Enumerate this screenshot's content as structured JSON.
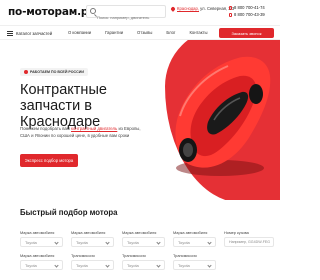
{
  "header": {
    "logo": "по-моторам.рф",
    "search_placeholder": "Поиск: например, двигатель",
    "location_city": "Краснодар,",
    "location_address": " ул. Северная, 3/3",
    "phones": [
      "8 800 700-41-74",
      "8 800 700-43-39"
    ]
  },
  "nav": {
    "catalog": "Каталог запчастей",
    "links": [
      "О компании",
      "Гарантии",
      "Отзывы",
      "Блог",
      "Контакты"
    ],
    "callback": "Заказать звонок"
  },
  "hero": {
    "badge": "РАБОТАЕМ ПО ВСЕЙ РОССИИ",
    "title": "Контрактные запчасти в Краснодаре",
    "desc_part1": "Поможем подобрать вам ",
    "desc_link": "контрактный двигатель",
    "desc_part2": " из Европы, США и Японии по хорошей цене, в удобные вам сроки",
    "button": "Экспресс подбор мотора"
  },
  "quick_pick": {
    "title": "Быстрый подбор мотора",
    "row1": [
      {
        "label": "Марка автомобиля",
        "value": "Toyota"
      },
      {
        "label": "Марка автомобиля",
        "value": "Toyota"
      },
      {
        "label": "Марка автомобиля",
        "value": "Toyota"
      },
      {
        "label": "Марка автомобиля",
        "value": "Toyota"
      },
      {
        "label": "Номер кузова",
        "value": "Например, GG4DW-FEG"
      }
    ],
    "row2": [
      {
        "label": "Марка автомобиля",
        "value": "Toyota"
      },
      {
        "label": "Трансмиссия",
        "value": "Toyota"
      },
      {
        "label": "Трансмиссия",
        "value": "Toyota"
      },
      {
        "label": "Трансмиссия",
        "value": "Toyota"
      }
    ]
  },
  "colors": {
    "accent": "#e0282c",
    "hero_red": "#e53035"
  },
  "icons": [
    "search-icon",
    "pin-icon",
    "phone-icon",
    "burger-icon",
    "chevron-down-icon"
  ]
}
